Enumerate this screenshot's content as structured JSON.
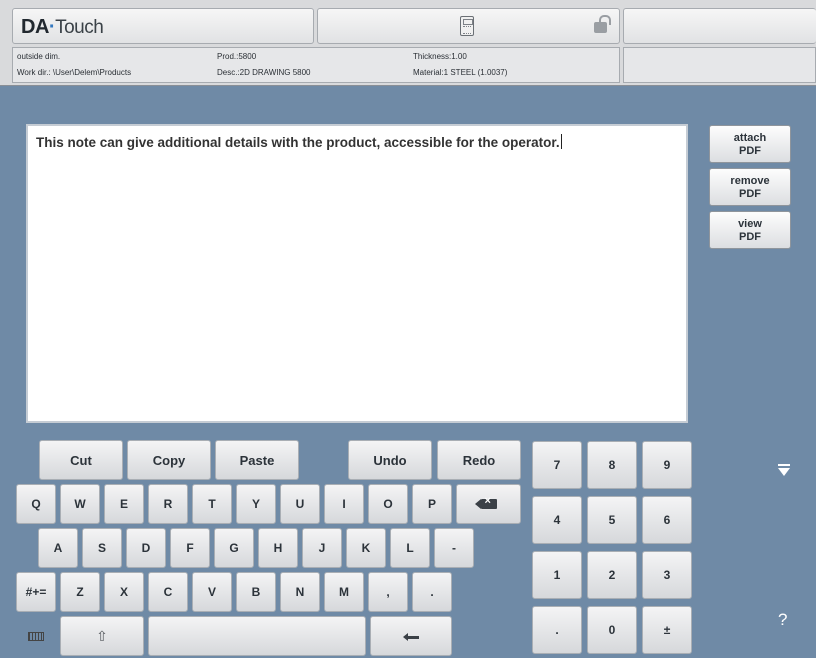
{
  "header": {
    "logo_main": "DA",
    "logo_dot": "·",
    "logo_sub": "Touch",
    "info": {
      "mode": "outside dim.",
      "workdir": "Work dir.: \\User\\Delem\\Products",
      "prod": "Prod.:5800",
      "desc": "Desc.:2D DRAWING 5800",
      "thickness": "Thickness:1.00",
      "material": "Material:1 STEEL (1.0037)"
    }
  },
  "note": {
    "text": "This note can give additional details with the product, accessible for the operator."
  },
  "side_buttons": {
    "attach_1": "attach",
    "attach_2": "PDF",
    "remove_1": "remove",
    "remove_2": "PDF",
    "view_1": "view",
    "view_2": "PDF"
  },
  "edit_keys": {
    "cut": "Cut",
    "copy": "Copy",
    "paste": "Paste",
    "undo": "Undo",
    "redo": "Redo"
  },
  "keys": {
    "row1": [
      "Q",
      "W",
      "E",
      "R",
      "T",
      "Y",
      "U",
      "I",
      "O",
      "P"
    ],
    "row2": [
      "A",
      "S",
      "D",
      "F",
      "G",
      "H",
      "J",
      "K",
      "L",
      "-"
    ],
    "row3": [
      "#+=",
      "Z",
      "X",
      "C",
      "V",
      "B",
      "N",
      "M",
      ",",
      "."
    ]
  },
  "numpad": [
    "7",
    "8",
    "9",
    "4",
    "5",
    "6",
    "1",
    "2",
    "3",
    ".",
    "0",
    "±"
  ],
  "help": "?",
  "icons": {
    "backspace": "backspace-icon",
    "shift": "shift-icon",
    "enter": "enter-icon",
    "keyboard": "keyboard-icon",
    "calculator": "calculator-icon",
    "lock": "unlock-icon",
    "scroll": "arrow-down-icon"
  }
}
